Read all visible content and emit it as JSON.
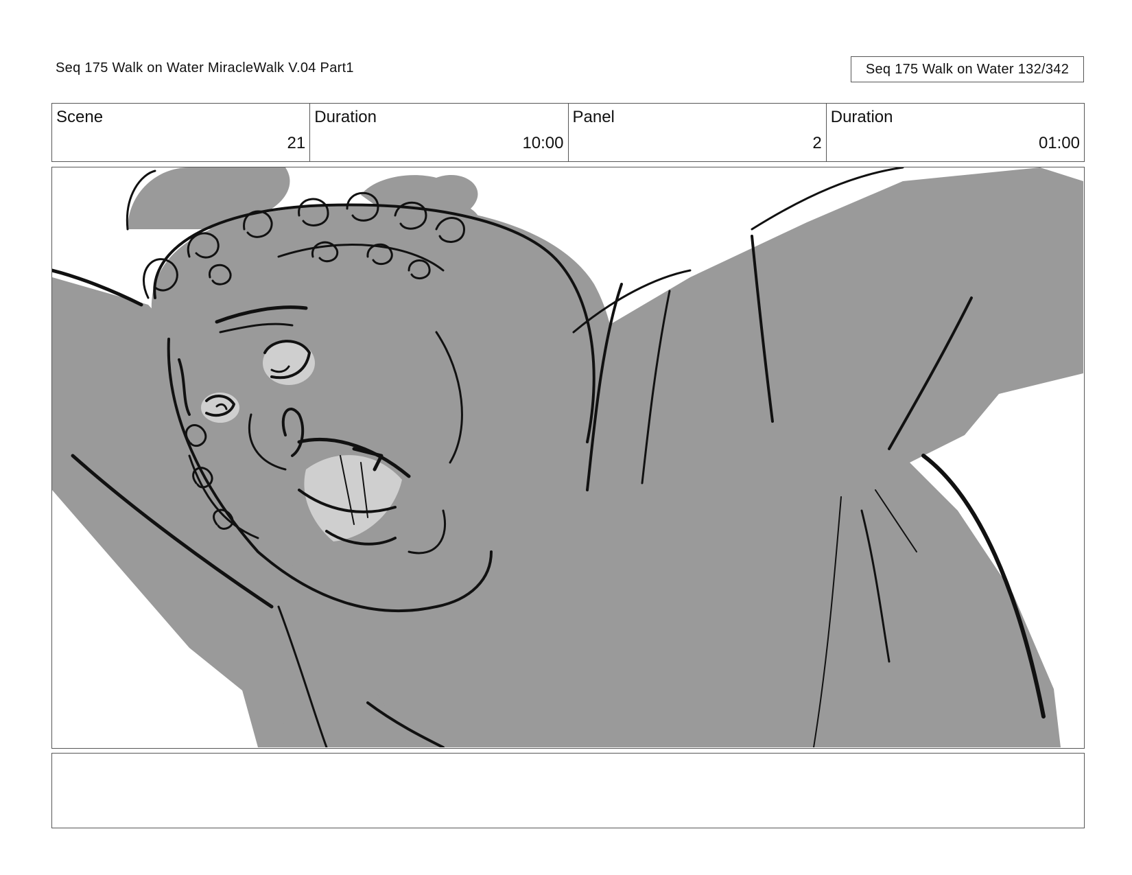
{
  "header": {
    "left_title": "Seq 175 Walk on Water  MiracleWalk V.04 Part1",
    "page_label": "Seq 175 Walk on Water 132/342"
  },
  "info": {
    "scene_label": "Scene",
    "scene_value": "21",
    "scene_duration_label": "Duration",
    "scene_duration_value": "10:00",
    "panel_label": "Panel",
    "panel_value": "2",
    "panel_duration_label": "Duration",
    "panel_duration_value": "01:00"
  },
  "notes": {
    "text": ""
  },
  "colors": {
    "fill_gray": "#9a9a9a",
    "light_gray": "#cfcfcf",
    "ink": "#111111",
    "border": "#555555"
  },
  "panel_art": {
    "icon": "storyboard-sketch-character-icon"
  }
}
